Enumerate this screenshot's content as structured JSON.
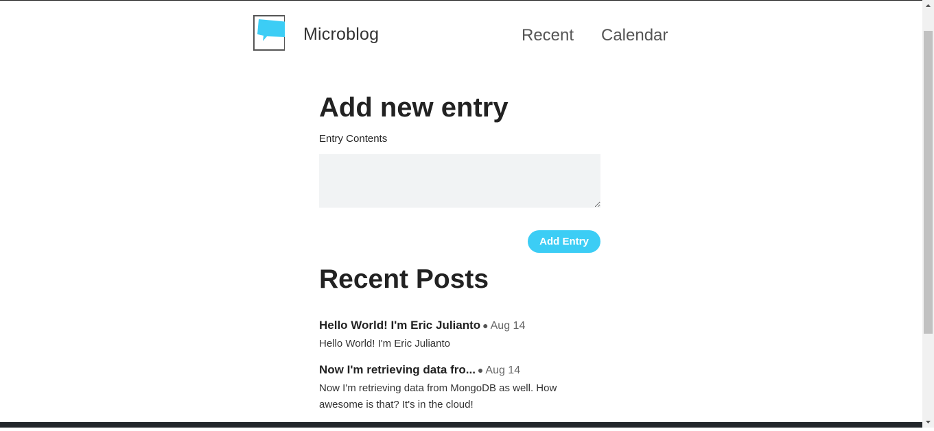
{
  "header": {
    "brand": "Microblog",
    "nav": [
      {
        "label": "Recent"
      },
      {
        "label": "Calendar"
      }
    ]
  },
  "form": {
    "title": "Add new entry",
    "field_label": "Entry Contents",
    "textarea_value": "",
    "submit_label": "Add Entry"
  },
  "recent": {
    "title": "Recent Posts",
    "separator": "●",
    "posts": [
      {
        "title": "Hello World! I'm Eric Julianto",
        "date": "Aug 14",
        "body": "Hello World! I'm Eric Julianto"
      },
      {
        "title": "Now I'm retrieving data fro...",
        "date": "Aug 14",
        "body": "Now I'm retrieving data from MongoDB as well. How awesome is that? It's in the cloud!"
      }
    ]
  },
  "colors": {
    "accent": "#3ccdf5",
    "textarea_bg": "#f1f3f4",
    "footer_bar": "#23272b"
  },
  "icons": {
    "logo": "speech-bubble-icon"
  }
}
